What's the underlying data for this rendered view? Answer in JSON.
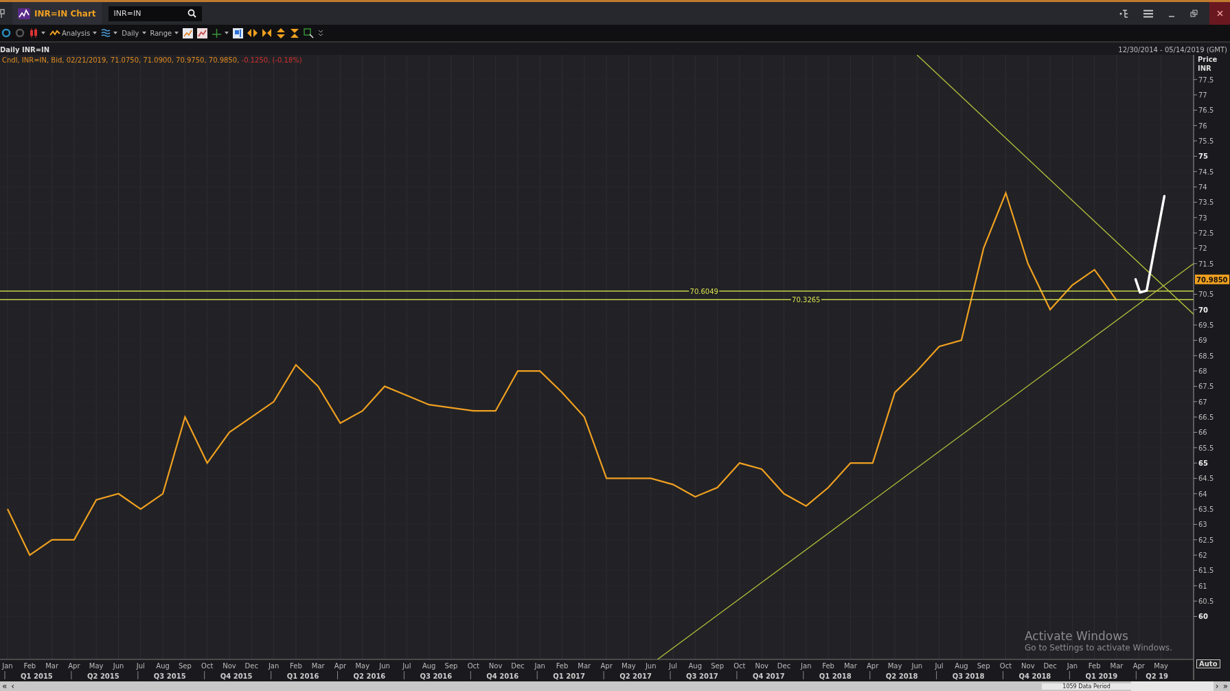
{
  "window": {
    "tab_title": "INR=IN Chart",
    "search": {
      "value": "INR=IN"
    }
  },
  "toolbar": {
    "labels": [
      "Analysis",
      "Daily",
      "Range"
    ]
  },
  "chart_header": {
    "title": "Daily INR=IN",
    "date_range": "12/30/2014 - 05/14/2019 (GMT)"
  },
  "legend": {
    "text": "Cndl, INR=IN, Bid, 02/21/2019, 71.0750, 71.0900, 70.9750, 70.9850,",
    "change": "-0.1250, (-0.18%)"
  },
  "axis_header": "Price",
  "last_price": "70.9850",
  "chart_data": {
    "type": "line",
    "ylabel": "INR",
    "categories": [
      "Jan",
      "Feb",
      "Mar",
      "Apr",
      "May",
      "Jun",
      "Jul",
      "Aug",
      "Sep",
      "Oct",
      "Nov",
      "Dec",
      "Jan",
      "Feb",
      "Mar",
      "Apr",
      "May",
      "Jun",
      "Jul",
      "Aug",
      "Sep",
      "Oct",
      "Nov",
      "Dec",
      "Jan",
      "Feb",
      "Mar",
      "Apr",
      "May",
      "Jun",
      "Jul",
      "Aug",
      "Sep",
      "Oct",
      "Nov",
      "Dec",
      "Jan",
      "Feb",
      "Mar",
      "Apr",
      "May",
      "Jun",
      "Jul",
      "Aug",
      "Sep",
      "Oct",
      "Nov",
      "Dec",
      "Jan",
      "Feb",
      "Mar",
      "Apr",
      "May"
    ],
    "series": [
      {
        "color": "#f0a020",
        "values": [
          63.5,
          62.0,
          62.5,
          62.5,
          63.8,
          64.0,
          63.5,
          64.0,
          66.5,
          65.0,
          66.0,
          66.5,
          67.0,
          68.2,
          67.5,
          66.3,
          66.7,
          67.5,
          67.2,
          66.9,
          66.8,
          66.7,
          66.7,
          68.0,
          68.0,
          67.3,
          66.5,
          64.5,
          64.5,
          64.5,
          64.3,
          63.9,
          64.2,
          65.0,
          64.8,
          64.0,
          63.6,
          64.2,
          65.0,
          65.0,
          67.3,
          68.0,
          68.8,
          69.0,
          72.0,
          73.8,
          71.5,
          70.0,
          70.8,
          71.3,
          70.3,
          null,
          null
        ]
      }
    ],
    "ylim": [
      58.6,
      78.3
    ],
    "yticks": [
      60,
      60.5,
      61,
      61.5,
      62,
      62.5,
      63,
      63.5,
      64,
      64.5,
      65,
      65.5,
      66,
      66.5,
      67,
      67.5,
      68,
      68.5,
      69,
      69.5,
      70,
      70.5,
      71.5,
      72,
      72.5,
      73,
      73.5,
      74,
      74.5,
      75,
      75.5,
      76,
      76.5,
      77,
      77.5
    ],
    "grid": true,
    "ref_lines": [
      {
        "axis": "y",
        "value": 70.6049,
        "label": "70.6049"
      },
      {
        "axis": "y",
        "value": 70.3265,
        "label": "70.3265"
      }
    ]
  },
  "quarters": [
    "Q1 2015",
    "Q2 2015",
    "Q3 2015",
    "Q4 2015",
    "Q1 2016",
    "Q2 2016",
    "Q3 2016",
    "Q4 2016",
    "Q1 2017",
    "Q2 2017",
    "Q3 2017",
    "Q4 2017",
    "Q1 2018",
    "Q2 2018",
    "Q3 2018",
    "Q4 2018",
    "Q1 2019",
    "Q2 19"
  ],
  "auto_button": "Auto",
  "watermark": [
    "Activate Windows",
    "Go to Settings to activate Windows."
  ],
  "scrollbar": {
    "left": [
      "«",
      "‹"
    ],
    "label": "1059 Data Period",
    "right": [
      "›",
      "»"
    ]
  }
}
